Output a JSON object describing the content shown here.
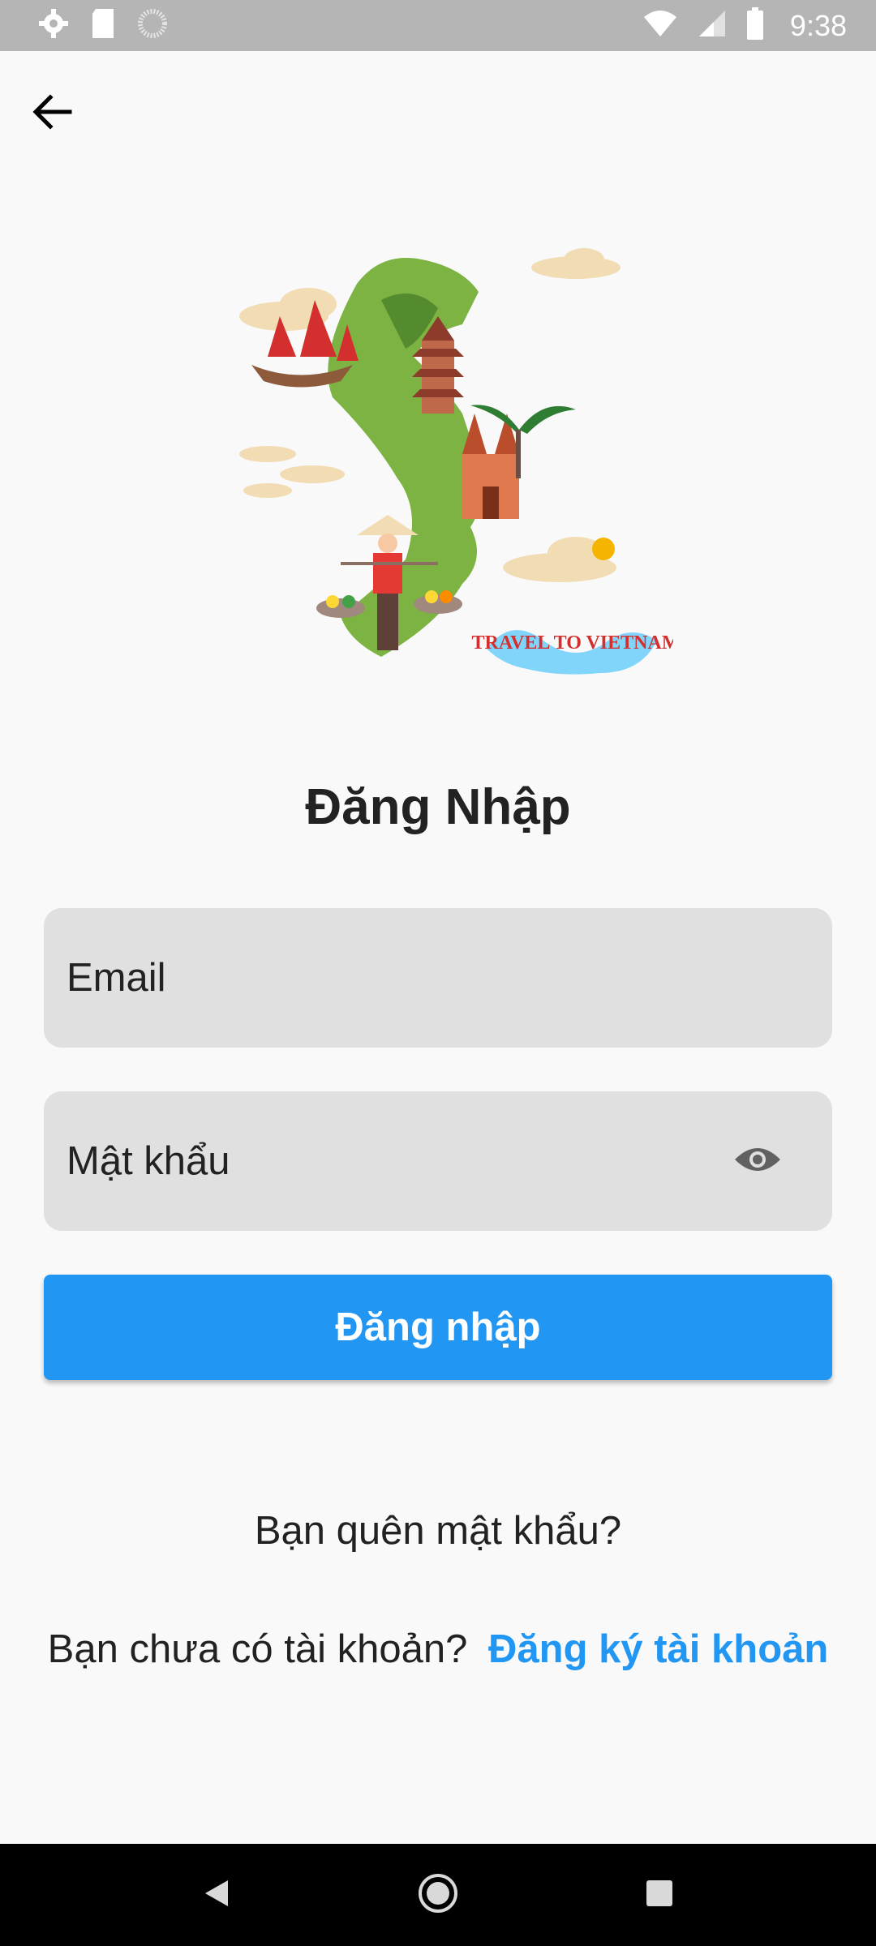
{
  "status_bar": {
    "time": "9:38",
    "icons": [
      "settings-icon",
      "sd-card-icon",
      "loading-icon",
      "wifi-icon",
      "signal-icon",
      "battery-icon"
    ]
  },
  "header": {
    "back_icon": "arrow-left-icon"
  },
  "illustration": {
    "caption": "TRAVEL TO VIETNAM"
  },
  "login": {
    "title": "Đăng Nhập",
    "email_placeholder": "Email",
    "email_value": "",
    "password_placeholder": "Mật khẩu",
    "password_value": "",
    "password_toggle_icon": "eye-icon",
    "submit_label": "Đăng nhập",
    "forgot_password": "Bạn quên mật khẩu?",
    "no_account_text": "Bạn chưa có tài khoản?",
    "signup_link": "Đăng ký tài khoản"
  },
  "colors": {
    "primary": "#2196f3",
    "field_bg": "#e0e0e0",
    "page_bg": "#f9f9f9",
    "status_bar_bg": "#b5b5b5",
    "nav_bar_bg": "#000000"
  },
  "nav_bar": {
    "icons": [
      "back-triangle-icon",
      "home-circle-icon",
      "recents-square-icon"
    ]
  }
}
